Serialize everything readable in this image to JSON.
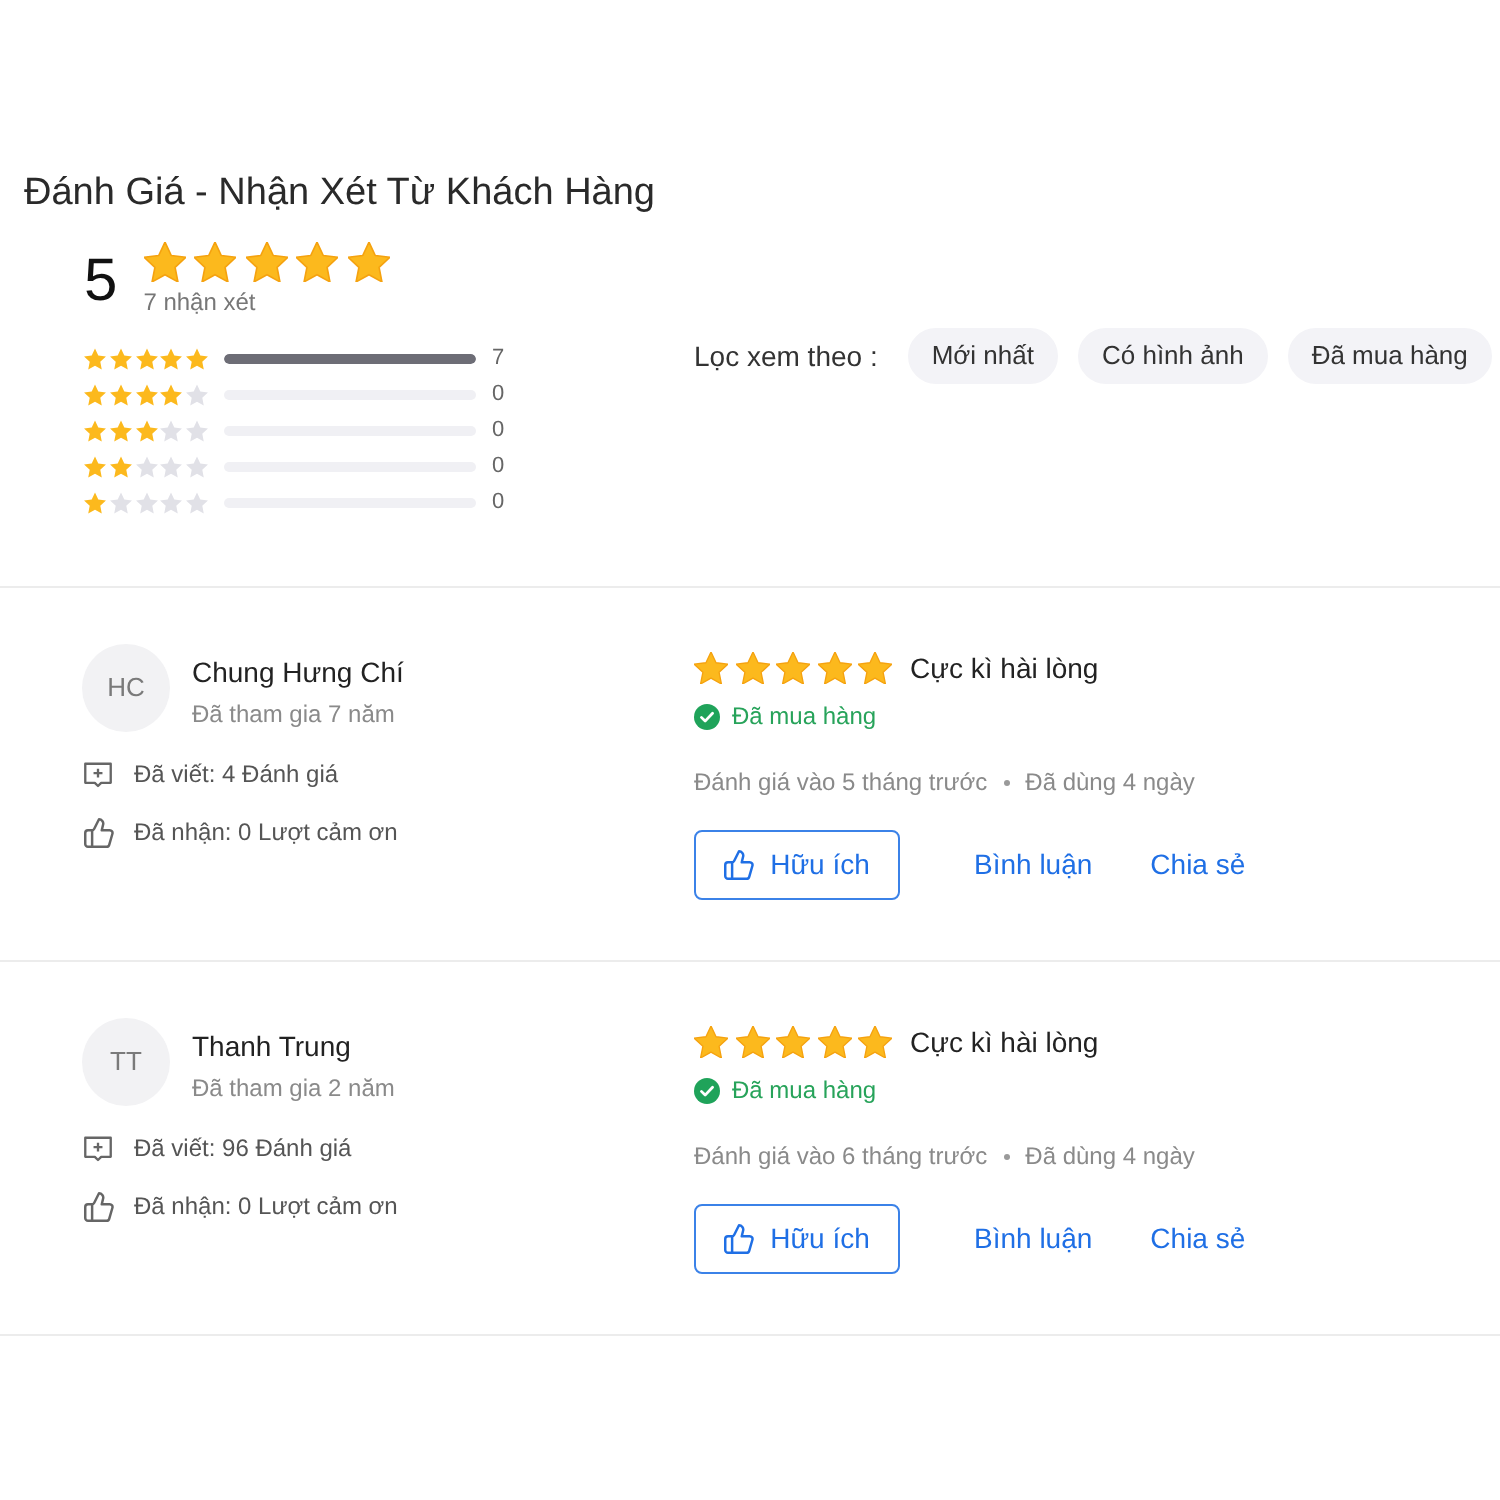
{
  "title": "Đánh Giá - Nhận Xét Từ Khách Hàng",
  "summary": {
    "score": "5",
    "stars": 5,
    "count": "7 nhận xét"
  },
  "distribution": [
    {
      "stars": 5,
      "level": 1,
      "count": "7"
    },
    {
      "stars": 4,
      "level": 0,
      "count": "0"
    },
    {
      "stars": 3,
      "level": 0,
      "count": "0"
    },
    {
      "stars": 2,
      "level": 0,
      "count": "0"
    },
    {
      "stars": 1,
      "level": 0,
      "count": "0"
    }
  ],
  "filter": {
    "label": "Lọc xem theo :",
    "options": [
      {
        "label": "Mới nhất",
        "selected": false
      },
      {
        "label": "Có hình ảnh",
        "selected": false
      },
      {
        "label": "Đã mua hàng",
        "selected": false
      }
    ]
  },
  "reviews": [
    {
      "initials": "HC",
      "name": "Chung Hưng Chí",
      "joined": "Đã tham gia 7 năm",
      "written": "Đã viết: 4 Đánh giá",
      "received": "Đã nhận: 0 Lượt cảm ơn",
      "stars": 5,
      "verdict": "Cực kì hài lòng",
      "badge": "Đã mua hàng",
      "posted": "Đánh giá vào 5 tháng trước",
      "usage": "Đã dùng 4 ngày",
      "actions": [
        {
          "kind": "outlined",
          "label": "Hữu ích"
        },
        {
          "kind": "link",
          "label": "Bình luận"
        },
        {
          "kind": "link",
          "label": "Chia sẻ"
        }
      ]
    },
    {
      "initials": "TT",
      "name": "Thanh Trung",
      "joined": "Đã tham gia 2 năm",
      "written": "Đã viết: 96 Đánh giá",
      "received": "Đã nhận: 0 Lượt cảm ơn",
      "stars": 5,
      "verdict": "Cực kì hài lòng",
      "badge": "Đã mua hàng",
      "posted": "Đánh giá vào 6 tháng trước",
      "usage": "Đã dùng 4 ngày",
      "actions": [
        {
          "kind": "outlined",
          "label": "Hữu ích"
        },
        {
          "kind": "link",
          "label": "Bình luận"
        },
        {
          "kind": "link",
          "label": "Chia sẻ"
        }
      ]
    }
  ]
}
